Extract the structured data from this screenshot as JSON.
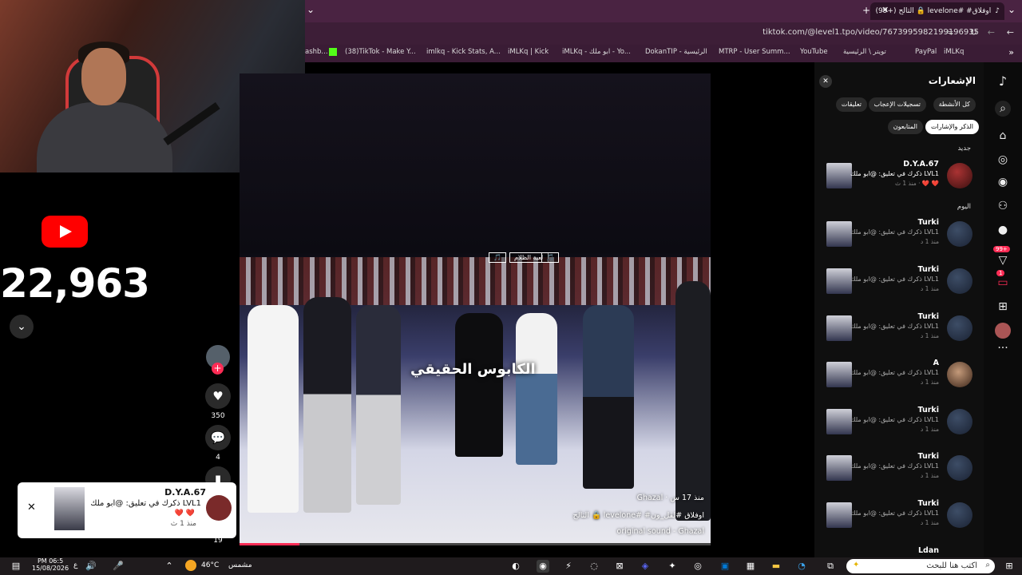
{
  "browser": {
    "new_tab_symbol": "+",
    "tab_title": "(99+) التالح 🔒 levelone# #اوفلاق",
    "url": "tiktok.com/@level1.tpo/video/7673995982199196935",
    "bookmarks": [
      "ashb...",
      "(38)TikTok - Make Y...",
      "imlkq - Kick Stats, A...",
      "iMLKq | Kick",
      "iMLKq - ابو ملك - Yo...",
      "DokanTIP - الرئيسية",
      "MTRP - User Summ...",
      "YouTube",
      "تويتر \\ الرئيسية",
      "PayPal",
      "iMLKq"
    ]
  },
  "left_panel": {
    "subscriber_count": "22,963",
    "youtube_icon": "youtube-icon"
  },
  "video": {
    "caption": "الكابوس الحقيقي",
    "top_tags": [
      "🎵",
      "لعبة الظلام",
      "🎵"
    ],
    "author": "Ghazal · منذ 17 س",
    "description": "التالح 🔒 levelone# #اوفلاق #لقل_ون",
    "sound": "original sound - Ghazal",
    "progress_percent": 12.7
  },
  "actions": {
    "like_count": "350",
    "comment_count": "4",
    "share_count": "19"
  },
  "toast": {
    "name": "D.Y.A.67",
    "text": "ذكرك في تعليق: @ابو ملك LVL1",
    "hearts": "❤️ ❤️",
    "time": "منذ 1 ث",
    "close_symbol": "✕"
  },
  "notifications": {
    "close_symbol": "✕",
    "title": "الإشعارات",
    "chips": [
      {
        "label": "كل الأنشطة",
        "active": false
      },
      {
        "label": "تسجيلات الإعجاب",
        "active": false
      },
      {
        "label": "تعليقات",
        "active": false
      },
      {
        "label": "الذكر والإشارات",
        "active": true
      },
      {
        "label": "المتابعون",
        "active": false
      }
    ],
    "section_new": "جديد",
    "section_today": "اليوم",
    "new_item": {
      "name": "D.Y.A.67",
      "text": "ذكرك في تعليق: @ابو ملك LVL1",
      "time": "منذ 1 ث · ❤️ ❤️"
    },
    "items": [
      {
        "name": "Turki",
        "text": "ذكرك في تعليق: @ابو ملك LVL1",
        "time": "منذ 1 د"
      },
      {
        "name": "Turki",
        "text": "ذكرك في تعليق: @ابو ملك LVL1",
        "time": "منذ 1 د"
      },
      {
        "name": "Turki",
        "text": "ذكرك في تعليق: @ابو ملك LVL1",
        "time": "منذ 1 د"
      },
      {
        "name": "A",
        "text": "ذكرك في تعليق: @ابو ملك LVL1",
        "time": "منذ 1 د"
      },
      {
        "name": "Turki",
        "text": "ذكرك في تعليق: @ابو ملك LVL1",
        "time": "منذ 1 د"
      },
      {
        "name": "Turki",
        "text": "ذكرك في تعليق: @ابو ملك LVL1",
        "time": "منذ 1 د"
      },
      {
        "name": "Turki",
        "text": "ذكرك في تعليق: @ابو ملك LVL1",
        "time": "منذ 1 د"
      },
      {
        "name": "Ldan",
        "text": "",
        "time": ""
      }
    ]
  },
  "sidebar": {
    "inbox_badge": "99+",
    "messages_badge": "1",
    "more_symbol": "···"
  },
  "taskbar": {
    "time": "PM 06:5",
    "date": "15/08/2026",
    "lang": "ع",
    "weather": "46°C",
    "weather_text": "مشمس",
    "search_placeholder": "اكتب هنا للبحث"
  },
  "colors": {
    "tiktok_red": "#fe2c55",
    "browser_tab": "#4a2342",
    "youtube_red": "#ff0000"
  }
}
